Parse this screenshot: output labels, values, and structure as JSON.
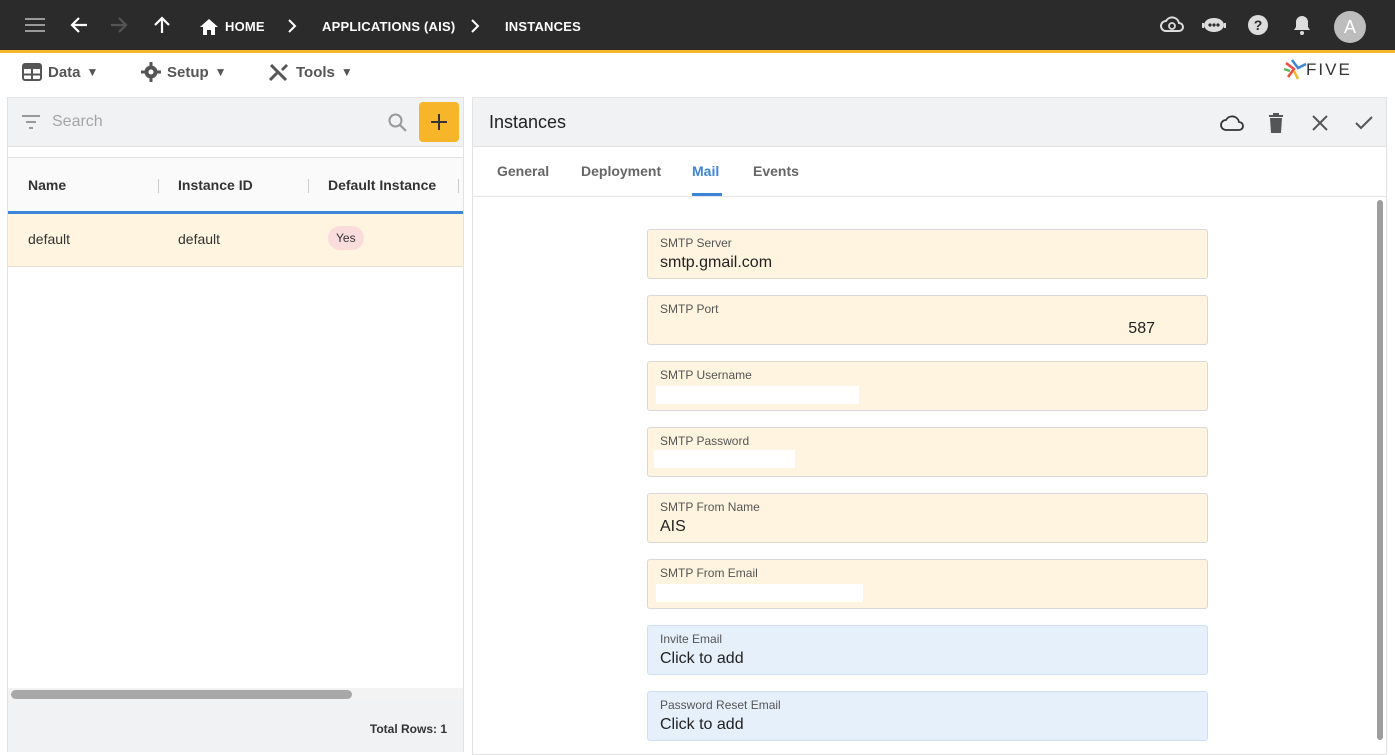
{
  "appbar": {
    "breadcrumbs": [
      "HOME",
      "APPLICATIONS (AIS)",
      "INSTANCES"
    ],
    "avatar_letter": "A",
    "bar_color": "#2b2b2b",
    "accent": "#f7b529",
    "icons": [
      "menu-icon",
      "back-arrow-icon",
      "forward-arrow-icon",
      "up-arrow-icon",
      "home-icon",
      "cloud-sync-icon",
      "chatbot-icon",
      "help-icon",
      "notifications-icon"
    ]
  },
  "menubar": {
    "items": [
      {
        "label": "Data",
        "icon": "table-icon"
      },
      {
        "label": "Setup",
        "icon": "gear-icon"
      },
      {
        "label": "Tools",
        "icon": "tools-icon"
      }
    ],
    "logo_text": "FIVE"
  },
  "left": {
    "search_placeholder": "Search",
    "columns": [
      "Name",
      "Instance ID",
      "Default Instance"
    ],
    "rows": [
      {
        "name": "default",
        "instance_id": "default",
        "default_instance": "Yes"
      }
    ],
    "total_rows": "Total Rows: 1"
  },
  "right": {
    "title": "Instances",
    "tabs": [
      "General",
      "Deployment",
      "Mail",
      "Events"
    ],
    "active_tab": "Mail",
    "fields": [
      {
        "label": "SMTP Server",
        "value": "smtp.gmail.com"
      },
      {
        "label": "SMTP Port",
        "value": "587"
      },
      {
        "label": "SMTP Username",
        "value": ""
      },
      {
        "label": "SMTP Password",
        "value": ""
      },
      {
        "label": "SMTP From Name",
        "value": "AIS"
      },
      {
        "label": "SMTP From Email",
        "value": ""
      },
      {
        "label": "Invite Email",
        "value": "Click to add"
      },
      {
        "label": "Password Reset Email",
        "value": "Click to add"
      }
    ],
    "active_color": "#3b86d6"
  }
}
